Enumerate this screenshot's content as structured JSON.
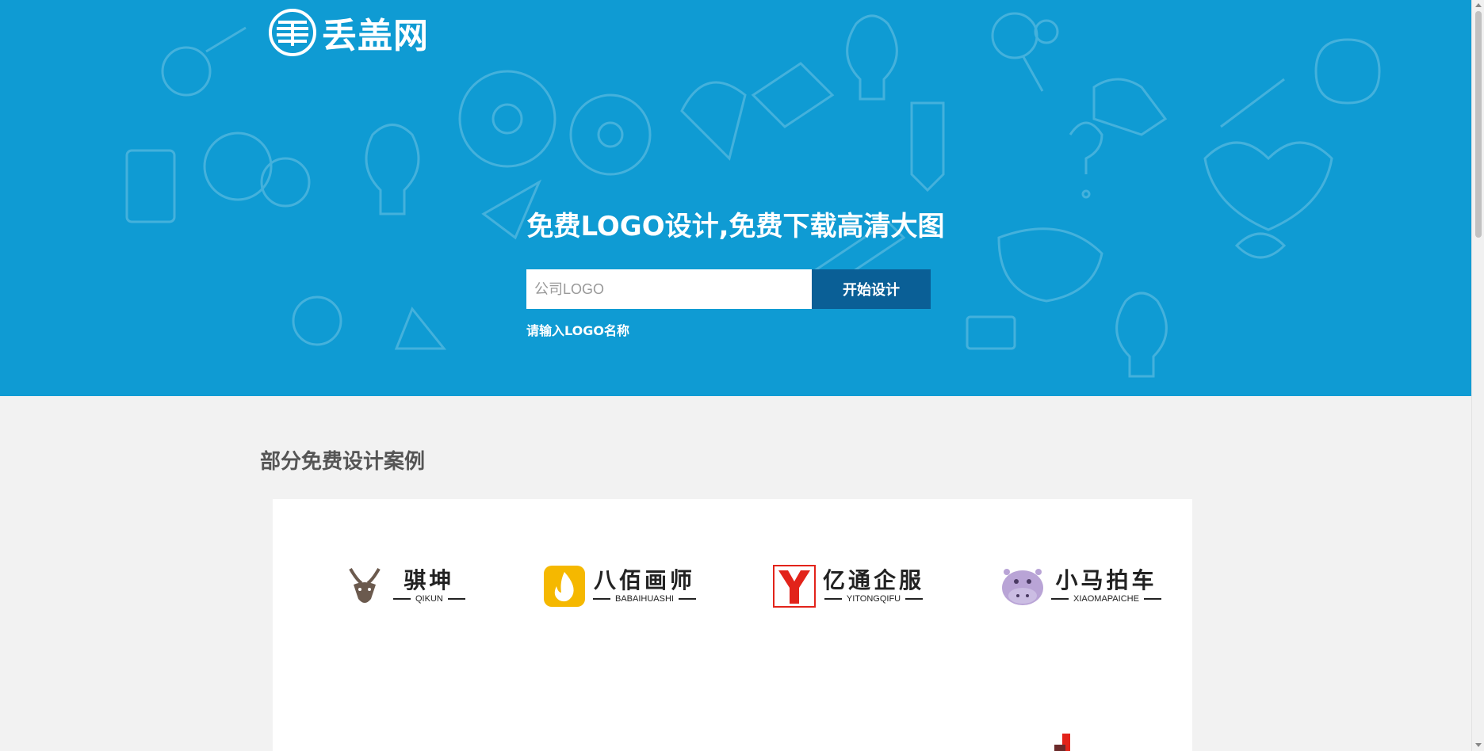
{
  "header": {
    "logo_text": "丢盖网",
    "logo_icon": "stacked-stripes-circle-icon"
  },
  "hero": {
    "title": "免费LOGO设计,免费下载高清大图",
    "search_placeholder": "公司LOGO",
    "button_label": "开始设计",
    "hint": "请输入LOGO名称",
    "background_color": "#0f9bd3",
    "button_color": "#0a5f96"
  },
  "cases": {
    "title": "部分免费设计案例",
    "items": [
      {
        "name": "骐坤",
        "sub": "QIKUN",
        "icon": "antelope-head-icon",
        "color": "#6b5a4e"
      },
      {
        "name": "八佰画师",
        "sub": "BABAIHUASHI",
        "icon": "flame-drop-icon",
        "color": "#f5b800"
      },
      {
        "name": "亿通企服",
        "sub": "YITONGQIFU",
        "icon": "letter-y-icon",
        "color": "#e2231a"
      },
      {
        "name": "小马拍车",
        "sub": "XIAOMAPAICHE",
        "icon": "hippo-icon",
        "color": "#b9a4d6"
      }
    ]
  }
}
